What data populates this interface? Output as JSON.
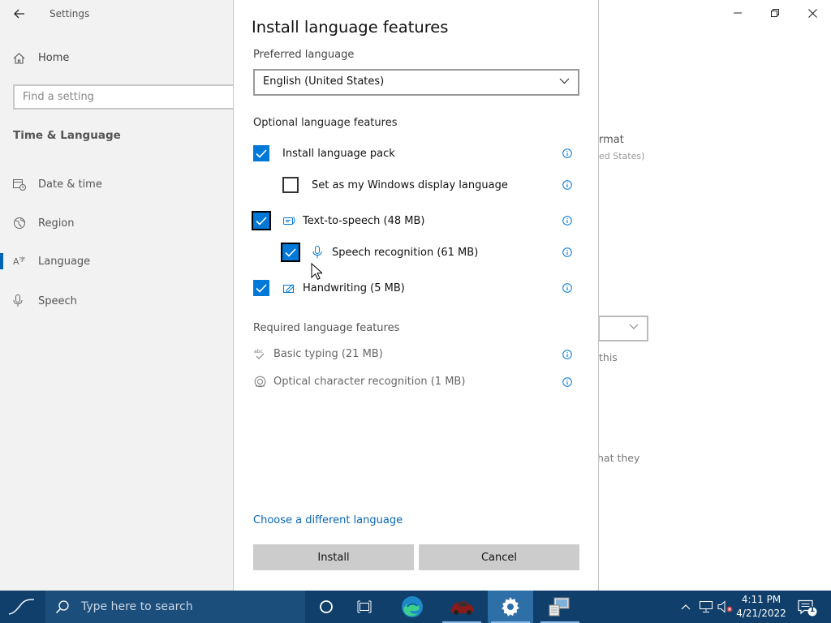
{
  "settings": {
    "app_title": "Settings",
    "nav": {
      "home": "Home",
      "search_placeholder": "Find a setting",
      "section": "Time & Language",
      "items": [
        {
          "label": "Date & time",
          "icon": "calendar-clock-icon"
        },
        {
          "label": "Region",
          "icon": "globe-icon"
        },
        {
          "label": "Language",
          "icon": "language-icon"
        },
        {
          "label": "Speech",
          "icon": "microphone-icon"
        }
      ],
      "active_item": "Language"
    },
    "background_fragments": {
      "format": "rmat",
      "region": "ed States)",
      "this": "this",
      "that_they": "hat they"
    }
  },
  "dialog": {
    "title": "Install language features",
    "preferred_label": "Preferred language",
    "preferred_value": "English (United States)",
    "optional_label": "Optional language features",
    "features": [
      {
        "label": "Install language pack",
        "checked": true
      },
      {
        "label": "Set as my Windows display language",
        "checked": false
      },
      {
        "label": "Text-to-speech (48 MB)",
        "checked": true,
        "icon": "text-to-speech-icon"
      },
      {
        "label": "Speech recognition (61 MB)",
        "checked": true,
        "icon": "microphone-icon"
      },
      {
        "label": "Handwriting (5 MB)",
        "checked": true,
        "icon": "handwriting-icon"
      }
    ],
    "required_label": "Required language features",
    "required": [
      {
        "label": "Basic typing (21 MB)",
        "icon": "basic-typing-icon"
      },
      {
        "label": "Optical character recognition (1 MB)",
        "icon": "ocr-icon"
      }
    ],
    "choose_link": "Choose a different language",
    "install_button": "Install",
    "cancel_button": "Cancel"
  },
  "taskbar": {
    "search_placeholder": "Type here to search",
    "time": "4:11 PM",
    "date": "4/21/2022",
    "notification_count": "1",
    "accent_color": "#0078d7",
    "bar_color": "#0f3f6a"
  }
}
